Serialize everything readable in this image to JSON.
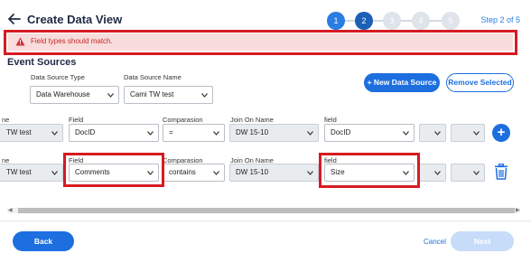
{
  "header": {
    "title": "Create Data View"
  },
  "stepper": {
    "steps": [
      "1",
      "2",
      "3",
      "4",
      "5"
    ],
    "current": 2,
    "label": "Step 2 of 5"
  },
  "error": {
    "message": "Field types should match."
  },
  "section": {
    "title": "Event Sources"
  },
  "source": {
    "type_label": "Data Source Type",
    "type_value": "Data Warehouse",
    "name_label": "Data Source Name",
    "name_value": "Cami TW test",
    "new_button": "+ New Data Source",
    "remove_button": "Remove Selected"
  },
  "rows": [
    {
      "name_label": "ne",
      "name_value": "TW test",
      "field_label": "Field",
      "field_value": "DocID",
      "comparison_label": "Comparasion",
      "comparison_value": "=",
      "join_label": "Join On Name",
      "join_value": "DW 15-10",
      "field2_label": "field",
      "field2_value": "DocID",
      "action": "plus-icon"
    },
    {
      "name_label": "ne",
      "name_value": "TW test",
      "field_label": "Field",
      "field_value": "Comments",
      "comparison_label": "Comparasion",
      "comparison_value": "contains",
      "join_label": "Join On Name",
      "join_value": "DW 15-10",
      "field2_label": "field",
      "field2_value": "Size",
      "action": "trash-icon"
    }
  ],
  "footer": {
    "back": "Back",
    "cancel": "Cancel",
    "next": "Next"
  },
  "colors": {
    "primary": "#1d6fe0",
    "error": "#d61b22",
    "error_bg": "#f9dcdc",
    "disabled": "#c7dcf8"
  }
}
